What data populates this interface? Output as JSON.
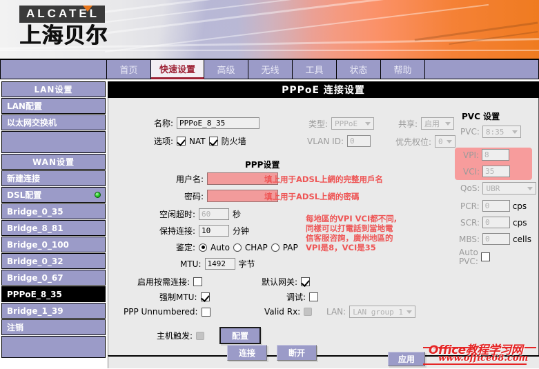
{
  "brand": {
    "name": "ALCATEL",
    "cn_name": "上海贝尔"
  },
  "nav": {
    "tabs": [
      {
        "label": "首页",
        "active": false
      },
      {
        "label": "快速设置",
        "active": true
      },
      {
        "label": "高级",
        "active": false
      },
      {
        "label": "无线",
        "active": false
      },
      {
        "label": "工具",
        "active": false
      },
      {
        "label": "状态",
        "active": false
      },
      {
        "label": "帮助",
        "active": false
      }
    ]
  },
  "sidebar": {
    "items": [
      {
        "label": "LAN设置",
        "type": "header"
      },
      {
        "label": "LAN配置",
        "type": "item"
      },
      {
        "label": "以太网交换机",
        "type": "item"
      },
      {
        "label": "",
        "type": "blank"
      },
      {
        "label": "WAN设置",
        "type": "header"
      },
      {
        "label": "新建连接",
        "type": "item"
      },
      {
        "label": "DSL配置",
        "type": "item",
        "indicator": "green-status-dot"
      },
      {
        "label": "Bridge_0_35",
        "type": "item"
      },
      {
        "label": "Bridge_8_81",
        "type": "item"
      },
      {
        "label": "Bridge_0_100",
        "type": "item"
      },
      {
        "label": "Bridge_0_32",
        "type": "item"
      },
      {
        "label": "Bridge_0_67",
        "type": "item"
      },
      {
        "label": "PPPoE_8_35",
        "type": "item",
        "active": true
      },
      {
        "label": "Bridge_1_39",
        "type": "item"
      },
      {
        "label": "注销",
        "type": "item"
      }
    ]
  },
  "panel": {
    "title": "PPPoE 连接设置",
    "top": {
      "name_label": "名称:",
      "name_value": "PPPoE_8_35",
      "type_label": "类型:",
      "type_value": "PPPoE",
      "share_label": "共享:",
      "share_value": "启用",
      "options_label": "选项:",
      "nat_label": "NAT",
      "nat_checked": true,
      "firewall_label": "防火墙",
      "firewall_checked": true,
      "vlan_label": "VLAN ID:",
      "vlan_value": "0",
      "priority_label": "优先权位:",
      "priority_value": "0"
    },
    "ppp": {
      "section_title": "PPP设置",
      "username_label": "用户名:",
      "username_value": "",
      "username_note": "填上用于ADSL上網的完整用戶名",
      "password_label": "密码:",
      "password_value": "",
      "password_note": "填上用于ADSL上網的密碼",
      "idle_label": "空闲超时:",
      "idle_value": "60",
      "idle_unit": "秒",
      "keepalive_label": "保持连接:",
      "keepalive_value": "10",
      "keepalive_unit": "分钟",
      "auth_label": "鉴定:",
      "auth_options": [
        {
          "label": "Auto",
          "selected": true
        },
        {
          "label": "CHAP",
          "selected": false
        },
        {
          "label": "PAP",
          "selected": false
        }
      ],
      "mtu_label": "MTU:",
      "mtu_value": "1492",
      "mtu_unit": "字节",
      "ondemand_label": "启用按需连接:",
      "ondemand_checked": false,
      "gateway_label": "默认网关:",
      "gateway_checked": true,
      "forcemtu_label": "强制MTU:",
      "forcemtu_checked": true,
      "debug_label": "调试:",
      "debug_checked": false,
      "unnumbered_label": "PPP Unnumbered:",
      "unnumbered_checked": false,
      "validrx_label": "Valid Rx:",
      "lan_label": "LAN:",
      "lan_value": "LAN group 1",
      "hosttrigger_label": "主机触发:",
      "config_button": "配置"
    },
    "pvc": {
      "section_title": "PVC 设置",
      "pvc_label": "PVC:",
      "pvc_value": "8:35",
      "vpi_label": "VPI:",
      "vpi_value": "8",
      "vci_label": "VCI:",
      "vci_value": "35",
      "qos_label": "QoS:",
      "qos_value": "UBR",
      "pcr_label": "PCR:",
      "pcr_value": "0",
      "pcr_unit": "cps",
      "scr_label": "SCR:",
      "scr_value": "0",
      "scr_unit": "cps",
      "mbs_label": "MBS:",
      "mbs_value": "0",
      "mbs_unit": "cells",
      "autopvc_label_1": "Auto",
      "autopvc_label_2": "PVC:",
      "autopvc_checked": false,
      "note": "每地區的VPI VCI都不同，同樣可以打電話到當地電信客服咨詢，廣州地區的VPI是8，VCI是35",
      "note_lines": [
        "每地區的VPI VCI都不同,",
        "同樣可以打電話到當地電",
        "信客服咨詢，廣州地區的",
        "VPI是8，VCI是35"
      ]
    },
    "actions": {
      "connect": "连接",
      "disconnect": "断开",
      "apply": "应用"
    }
  },
  "watermark": {
    "line1": "Office教程学习网",
    "line2": "www.office68.com"
  },
  "colors": {
    "sidebar": "#9b9bc8",
    "active_tab_text": "#9d2235",
    "note_red": "#ee5555",
    "pink_field": "#f29b9b",
    "panel_bg": "#eaeaea",
    "status_green": "#2fd12f"
  }
}
